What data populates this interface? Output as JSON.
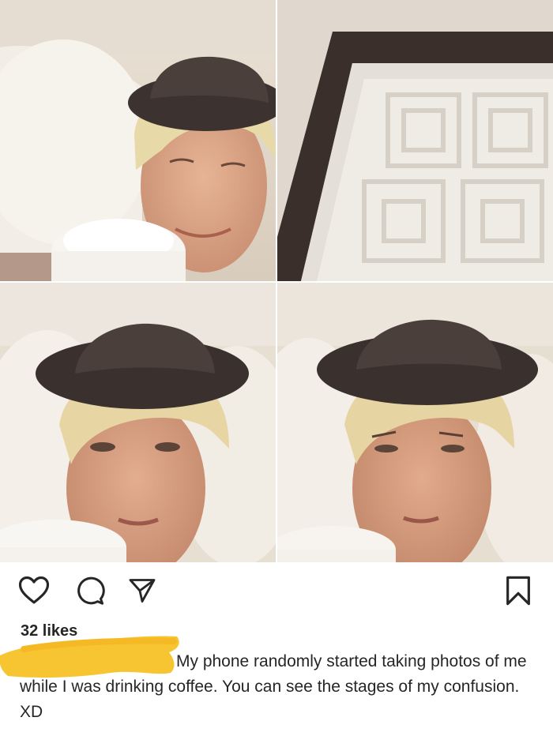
{
  "post": {
    "photos": [
      {
        "label": "photo-1"
      },
      {
        "label": "photo-2"
      },
      {
        "label": "photo-3"
      },
      {
        "label": "photo-4"
      }
    ],
    "icons": {
      "like": "heart-icon",
      "comment": "comment-icon",
      "share": "paper-plane-icon",
      "save": "bookmark-icon"
    },
    "likes_text": "32 likes",
    "caption_text": "My phone randomly started taking photos of me while I was drinking coffee. You can see the stages of my confusion. XD",
    "redaction_color": "#f7c531"
  }
}
